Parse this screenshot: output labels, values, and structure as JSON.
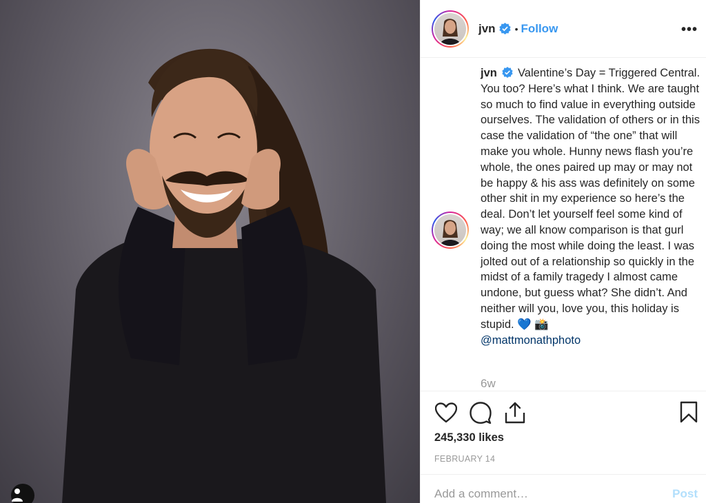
{
  "post": {
    "username": "jvn",
    "verified_icon": "verified-badge-icon",
    "separator": "•",
    "follow_label": "Follow",
    "more_label": "•••",
    "caption_user": "jvn",
    "caption_text": "Valentine’s Day = Triggered Central. You too? Here’s what I think. We are taught so much to find value in everything outside ourselves. The validation of others or in this case the validation of “the one” that will make you whole. Hunny news flash you’re whole, the ones paired up may or may not be happy & his ass was definitely on some other shit in my experience so here’s the deal. Don’t let yourself feel some kind of way; we all know comparison is that gurl doing the most while doing the least. I was jolted out of a relationship so quickly in the midst of a family tragedy I almost came undone, but guess what? She didn’t. And neither will you, love you, this holiday is stupid. 💙 📸",
    "caption_mention": "@mattmonathphoto",
    "time_ago": "6w",
    "likes": "245,330 likes",
    "date": "FEBRUARY 14"
  },
  "comment": {
    "placeholder": "Add a comment…",
    "post_label": "Post"
  },
  "colors": {
    "link": "#3897f0",
    "mention": "#003569",
    "muted": "#999999",
    "post_disabled": "#b2dffc"
  }
}
